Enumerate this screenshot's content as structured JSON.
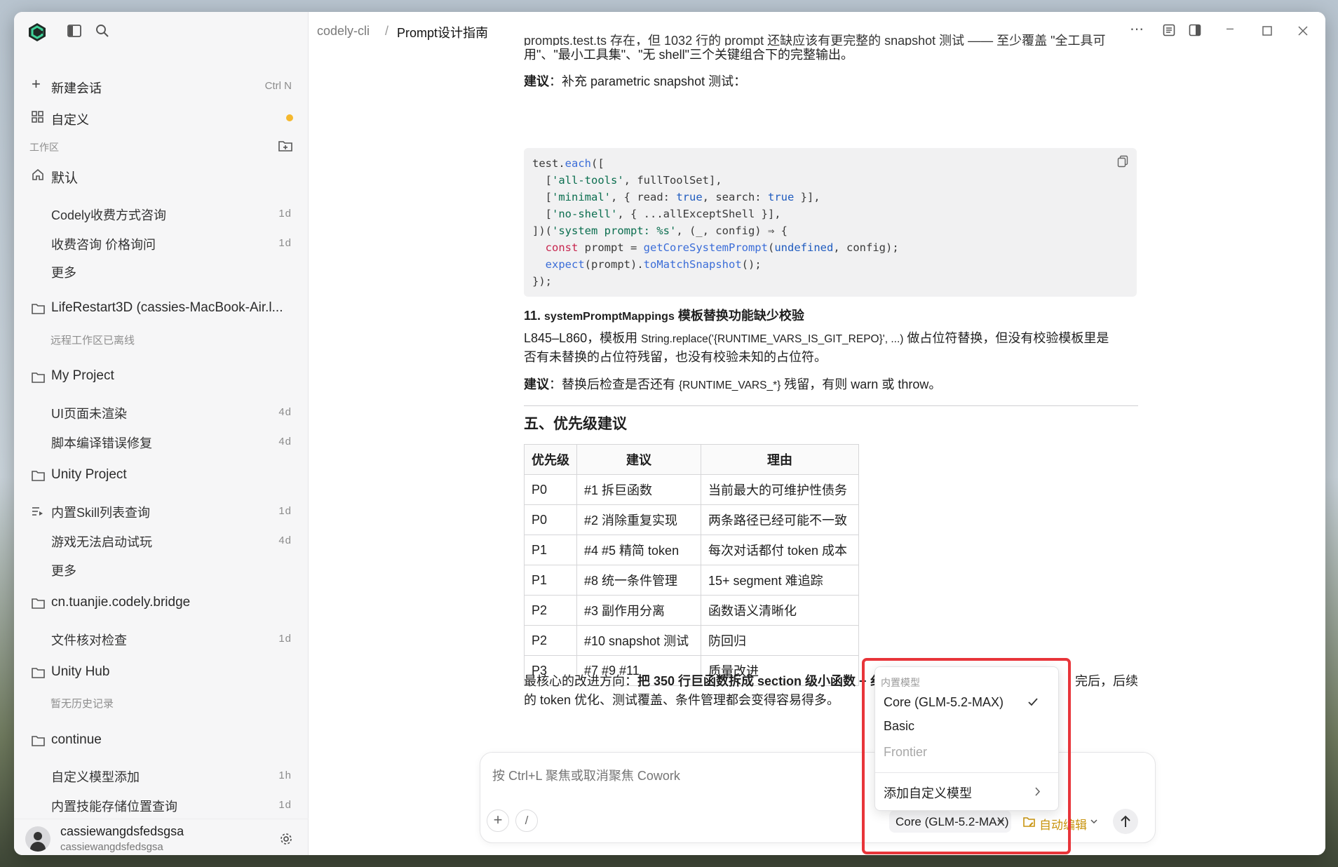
{
  "header": {
    "breadcrumb_root": "codely-cli",
    "breadcrumb_sep": "/",
    "page_title": "Prompt设计指南"
  },
  "sidebar": {
    "new_chat": {
      "label": "新建会话",
      "shortcut": "Ctrl N"
    },
    "customize": {
      "label": "自定义",
      "dot_color": "#f5b82e"
    },
    "workspace_label": "工作区",
    "groups": [
      {
        "name": "默认",
        "items": [
          {
            "label": "Codely收费方式咨询",
            "age": "1d"
          },
          {
            "label": "收费咨询 价格询问",
            "age": "1d"
          },
          {
            "label": "更多",
            "age": ""
          }
        ]
      },
      {
        "name": "LifeRestart3D (cassies-MacBook-Air.l...",
        "note": "远程工作区已离线"
      },
      {
        "name": "My Project",
        "items": [
          {
            "label": "UI页面未渲染",
            "age": "4d"
          },
          {
            "label": "脚本编译错误修复",
            "age": "4d"
          }
        ]
      },
      {
        "name": "Unity Project",
        "items": [
          {
            "label": "内置Skill列表查询",
            "age": "1d"
          },
          {
            "label": "游戏无法启动试玩",
            "age": "4d"
          },
          {
            "label": "更多",
            "age": ""
          }
        ]
      },
      {
        "name": "cn.tuanjie.codely.bridge",
        "items": [
          {
            "label": "文件核对检查",
            "age": "1d"
          }
        ]
      },
      {
        "name": "Unity Hub",
        "note": "暂无历史记录"
      },
      {
        "name": "continue",
        "items": [
          {
            "label": "自定义模型添加",
            "age": "1h"
          },
          {
            "label": "内置技能存储位置查询",
            "age": "1d"
          }
        ]
      }
    ],
    "user": {
      "name": "cassiewangdsfedsgsa",
      "sub": "cassiewangdsfedsgsa"
    }
  },
  "content": {
    "top_clip": "prompts.test.ts 存在，但 1032 行的 prompt 还缺应该有更完整的 snapshot 测试 —— 至少覆盖 \"全工具可",
    "top_line": "用\"、\"最小工具集\"、\"无 shell\"三个关键组合下的完整输出。",
    "suggest1_bold": "建议",
    "suggest1_rest": "：补充 parametric snapshot 测试：",
    "code_lines": [
      {
        "parts": [
          [
            "",
            "test."
          ],
          [
            "f",
            "each"
          ],
          [
            "",
            "(["
          ]
        ]
      },
      {
        "parts": [
          [
            "",
            "  ["
          ],
          [
            "s",
            "'all-tools'"
          ],
          [
            "",
            ", fullToolSet],"
          ]
        ]
      },
      {
        "parts": [
          [
            "",
            "  ["
          ],
          [
            "s",
            "'minimal'"
          ],
          [
            "",
            ", { read: "
          ],
          [
            "b",
            "true"
          ],
          [
            "",
            ", search: "
          ],
          [
            "b",
            "true"
          ],
          [
            "",
            " }],"
          ]
        ]
      },
      {
        "parts": [
          [
            "",
            "  ["
          ],
          [
            "s",
            "'no-shell'"
          ],
          [
            "",
            ", { ...allExceptShell }],"
          ]
        ]
      },
      {
        "parts": [
          [
            "",
            "])("
          ],
          [
            "s",
            "'system prompt: %s'"
          ],
          [
            "",
            ", (_, config) ⇒ {"
          ]
        ]
      },
      {
        "parts": [
          [
            "",
            "  "
          ],
          [
            "k",
            "const"
          ],
          [
            "",
            " prompt = "
          ],
          [
            "f",
            "getCoreSystemPrompt"
          ],
          [
            "",
            "("
          ],
          [
            "b",
            "undefined"
          ],
          [
            "",
            ", config);"
          ]
        ]
      },
      {
        "parts": [
          [
            "",
            "  "
          ],
          [
            "f",
            "expect"
          ],
          [
            "",
            "(prompt)."
          ],
          [
            "f",
            "toMatchSnapshot"
          ],
          [
            "",
            "();"
          ]
        ]
      },
      {
        "parts": [
          [
            "",
            "});"
          ]
        ]
      }
    ],
    "h11_num": "11. ",
    "h11_code": "systemPromptMappings",
    "h11_rest": " 模板替换功能缺少校验",
    "p11_a": "L845–L860，模板用 ",
    "p11_code": "String.replace('{RUNTIME_VARS_IS_GIT_REPO}', ...)",
    "p11_b": " 做占位符替换，但没有校验模板里是",
    "p11_line2": "否有未替换的占位符残留，也没有校验未知的占位符。",
    "suggest2_bold": "建议",
    "suggest2_a": "：替换后检查是否还有 ",
    "suggest2_code": "{RUNTIME_VARS_*}",
    "suggest2_b": " 残留，有则 warn 或 throw。",
    "section5": "五、优先级建议",
    "table": {
      "headers": [
        "优先级",
        "建议",
        "理由"
      ],
      "rows": [
        [
          "P0",
          "#1 拆巨函数",
          "当前最大的可维护性债务"
        ],
        [
          "P0",
          "#2 消除重复实现",
          "两条路径已经可能不一致"
        ],
        [
          "P1",
          "#4 #5 精简 token",
          "每次对话都付 token 成本"
        ],
        [
          "P1",
          "#8 统一条件管理",
          "15+ segment 难追踪"
        ],
        [
          "P2",
          "#3 副作用分离",
          "函数语义清晰化"
        ],
        [
          "P2",
          "#10 snapshot 测试",
          "防回归"
        ],
        [
          "P3",
          "#7 #9 #11",
          "质量改进"
        ]
      ]
    },
    "final_a": "最核心的改进方向：",
    "final_bold": "把 350 行巨函数拆成 section 级小函数 + 纟",
    "final_tail": "完后，后续",
    "final_line2": "的 token 优化、测试覆盖、条件管理都会变得容易得多。"
  },
  "composer": {
    "placeholder": "按 Ctrl+L 聚焦或取消聚焦 Cowork",
    "model_button": "Core (GLM-5.2-MAX)",
    "mode_button": "自动编辑",
    "mode_color": "#c8940f"
  },
  "model_menu": {
    "section_label": "内置模型",
    "options": [
      {
        "label": "Core (GLM-5.2-MAX)",
        "selected": true
      },
      {
        "label": "Basic",
        "selected": false
      },
      {
        "label": "Frontier",
        "selected": false,
        "disabled": true
      }
    ],
    "add_custom": "添加自定义模型"
  },
  "colors": {
    "accent": "#2fbf8a",
    "highlight_border": "#e8353a"
  }
}
